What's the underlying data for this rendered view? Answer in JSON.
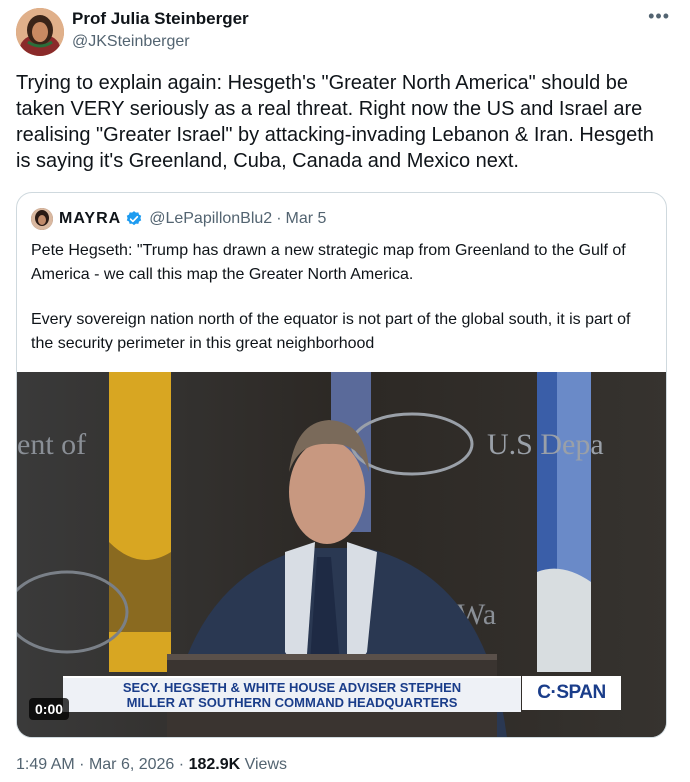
{
  "author": {
    "name": "Prof Julia Steinberger",
    "handle": "@JKSteinberger",
    "more_icon": "more-horizontal-icon"
  },
  "tweet": {
    "text": "Trying to explain again: Hesgeth's \"Greater North America\" should be taken VERY seriously as a real threat. Right now the US and Israel are realising \"Greater Israel\" by attacking-invading Lebanon & Iran. Hesgeth is saying it's Greenland, Cuba, Canada and Mexico next."
  },
  "quote": {
    "name": "MAYRA",
    "verified_icon": "verified-badge-icon",
    "handle": "@LePapillonBlu2",
    "separator": "·",
    "date": "Mar 5",
    "paragraph1": "Pete Hegseth: \"Trump has drawn a new strategic map from Greenland to the Gulf of America - we call this map the Greater North America.",
    "paragraph2": "Every sovereign nation north of the equator is not part of the global south, it is part of the security perimeter in this great neighborhood"
  },
  "video": {
    "duration": "0:00",
    "backdrop_text_left": "ent of",
    "backdrop_text_right": "U.S Depa",
    "backdrop_text_lower": "Wa",
    "chyron_line1": "SECY. HEGSETH & WHITE HOUSE ADVISER STEPHEN",
    "chyron_line2": "MILLER AT SOUTHERN COMMAND HEADQUARTERS",
    "network": "C·SPAN"
  },
  "footer": {
    "time": "1:49 AM",
    "sep1": "·",
    "date": "Mar 6, 2026",
    "sep2": "·",
    "views_count": "182.9K",
    "views_label": "Views"
  },
  "colors": {
    "text": "#0f1419",
    "secondary": "#536471",
    "border": "#cfd9de",
    "verified": "#1d9bf0",
    "cspan_blue": "#1a3d8a"
  }
}
